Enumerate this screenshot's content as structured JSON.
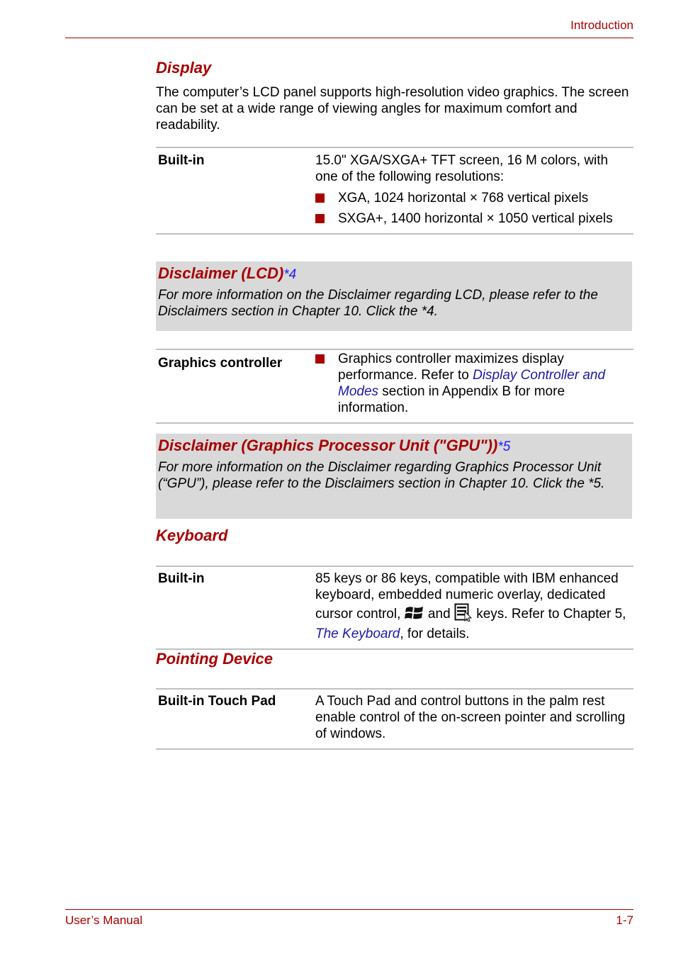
{
  "header": {
    "title": "Introduction"
  },
  "footer": {
    "left": "User’s Manual",
    "right": "1-7"
  },
  "display": {
    "heading": "Display",
    "intro": "The computer’s LCD panel supports high-resolution video graphics. The screen can be set at a wide range of viewing angles for maximum comfort and readability.",
    "builtin": {
      "label": "Built-in",
      "text": "15.0\" XGA/SXGA+ TFT screen, 16 M colors, with one of the following resolutions:",
      "bullets": [
        "XGA, 1024 horizontal × 768 vertical pixels",
        "SXGA+, 1400 horizontal × 1050 vertical pixels"
      ]
    },
    "disclaimer_lcd": {
      "title": "Disclaimer (LCD)",
      "ref": "*4",
      "body": "For more information on the Disclaimer regarding LCD, please refer to the Disclaimers section in Chapter 10. Click the *4."
    },
    "graphics_controller": {
      "label": "Graphics controller",
      "text_before": "Graphics controller maximizes display performance. Refer to ",
      "link": "Display Controller and Modes",
      "text_after": " section in Appendix B for more information."
    },
    "disclaimer_gpu": {
      "title": "Disclaimer (Graphics Processor Unit (\"GPU\"))",
      "ref": "*5",
      "body": "For more information on the Disclaimer regarding Graphics Processor Unit (“GPU”), please refer to the Disclaimers section in Chapter 10. Click the *5."
    }
  },
  "keyboard": {
    "heading": "Keyboard",
    "builtin": {
      "label": "Built-in",
      "text_1": "85 keys or 86 keys, compatible with IBM enhanced keyboard, embedded numeric overlay, dedicated cursor control, ",
      "icon_1": "windows-key-icon",
      "text_2": " and ",
      "icon_2": "application-key-icon",
      "text_3": " keys. Refer to Chapter 5, ",
      "link": "The Keyboard",
      "text_4": ", for details."
    }
  },
  "pointing": {
    "heading": "Pointing Device",
    "touchpad": {
      "label": "Built-in Touch Pad",
      "text": "A Touch Pad and control buttons in the palm rest enable control of the on-screen pointer and scrolling of windows."
    }
  },
  "colors": {
    "accent": "#a80000",
    "link": "#1a1aa6",
    "disclaimer_bg": "#d9d9d9",
    "rule": "#c0c0c0"
  }
}
